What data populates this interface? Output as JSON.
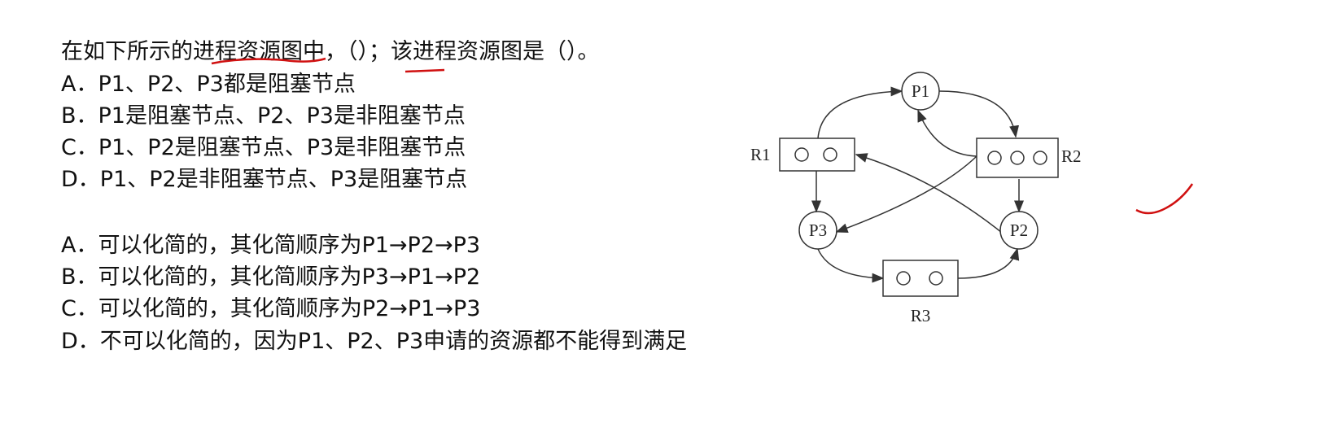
{
  "question": "在如下所示的进程资源图中，（）；该进程资源图是（）。",
  "group1": [
    "A．P1、P2、P3都是阻塞节点",
    "B．P1是阻塞节点、P2、P3是非阻塞节点",
    "C．P1、P2是阻塞节点、P3是非阻塞节点",
    "D．P1、P2是非阻塞节点、P3是阻塞节点"
  ],
  "group2": [
    "A．可以化简的，其化简顺序为P1→P2→P3",
    "B．可以化简的，其化简顺序为P3→P1→P2",
    "C．可以化简的，其化简顺序为P2→P1→P3",
    "D．不可以化简的，因为P1、P2、P3申请的资源都不能得到满足"
  ],
  "diagram": {
    "processes": [
      "P1",
      "P2",
      "P3"
    ],
    "resources": [
      {
        "name": "R1",
        "units": 2
      },
      {
        "name": "R2",
        "units": 3
      },
      {
        "name": "R3",
        "units": 2
      }
    ],
    "edges": [
      [
        "R1",
        "P1"
      ],
      [
        "P1",
        "R2"
      ],
      [
        "R2",
        "P1"
      ],
      [
        "R1",
        "P3"
      ],
      [
        "R2",
        "P2"
      ],
      [
        "R2",
        "P3"
      ],
      [
        "P2",
        "R1"
      ],
      [
        "P3",
        "R3"
      ],
      [
        "R3",
        "P2"
      ]
    ]
  },
  "colors": {
    "annotation": "#d01010"
  }
}
